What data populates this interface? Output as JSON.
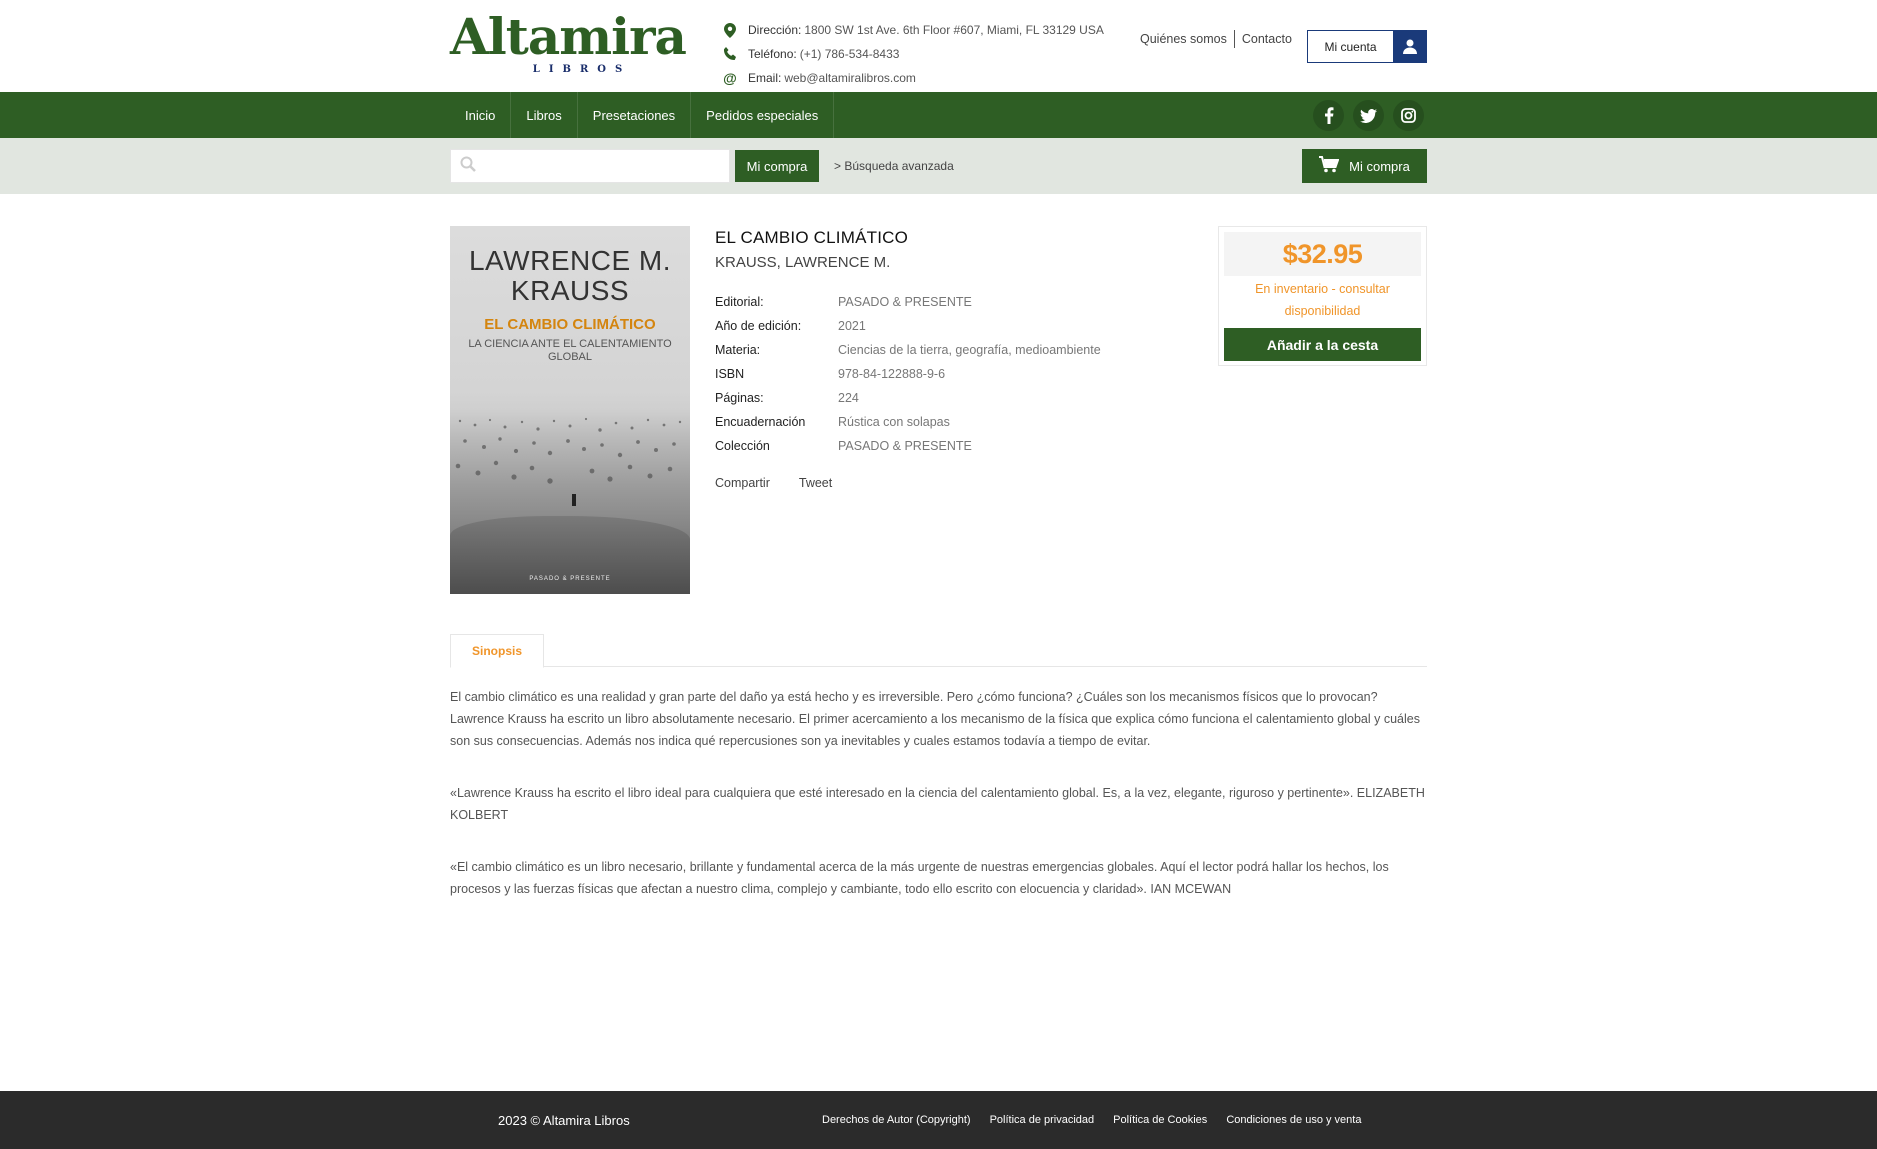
{
  "brand": {
    "logo_main": "Altamira",
    "logo_sub": "LIBROS",
    "primary_color": "#2e5e24",
    "accent_color": "#f0952a"
  },
  "contact": {
    "address_label": "Dirección:",
    "address": "1800 SW 1st Ave. 6th Floor #607, Miami, FL 33129 USA",
    "phone_label": "Teléfono:",
    "phone": "(+1) 786-534-8433",
    "email_label": "Email:",
    "email": "web@altamiralibros.com"
  },
  "top_links": {
    "about": "Quiénes somos",
    "contact": "Contacto",
    "account": "Mi cuenta"
  },
  "nav": {
    "items": [
      "Inicio",
      "Libros",
      "Presetaciones",
      "Pedidos especiales"
    ],
    "social": [
      "facebook-icon",
      "twitter-icon",
      "instagram-icon"
    ]
  },
  "search": {
    "placeholder": "",
    "button": "Mi compra",
    "advanced": "> Búsqueda avanzada",
    "cart": "Mi compra"
  },
  "book": {
    "cover": {
      "author": "LAWRENCE M. KRAUSS",
      "title": "EL CAMBIO CLIMÁTICO",
      "subtitle": "LA CIENCIA ANTE EL CALENTAMIENTO GLOBAL",
      "publisher": "PASADO & PRESENTE"
    },
    "title": "EL CAMBIO CLIMÁTICO",
    "author": "KRAUSS, LAWRENCE M.",
    "details": [
      {
        "label": "Editorial:",
        "value": "PASADO & PRESENTE"
      },
      {
        "label": "Año de edición:",
        "value": "2021"
      },
      {
        "label": "Materia:",
        "value": "Ciencias de la tierra, geografía, medioambiente"
      },
      {
        "label": "ISBN",
        "value": "978-84-122888-9-6"
      },
      {
        "label": "Páginas:",
        "value": "224"
      },
      {
        "label": "Encuadernación",
        "value": "Rústica con solapas"
      },
      {
        "label": "Colección",
        "value": "PASADO & PRESENTE"
      }
    ],
    "share": "Compartir",
    "tweet": "Tweet",
    "price": "$32.95",
    "stock": "En inventario - consultar disponibilidad",
    "add_to_cart": "Añadir a la cesta"
  },
  "tabs": {
    "synopsis": "Sinopsis"
  },
  "synopsis": [
    "El cambio climático es una realidad y gran parte del daño ya está hecho y es irreversible. Pero ¿cómo funciona? ¿Cuáles son los mecanismos físicos que lo provocan? Lawrence Krauss ha escrito un libro absolutamente necesario. El primer acercamiento a los mecanismo de la física que explica cómo funciona el calentamiento global y cuáles son sus consecuencias. Además nos indica qué repercusiones son ya inevitables y cuales estamos todavía a tiempo de evitar.",
    "«Lawrence Krauss ha escrito el libro ideal para cualquiera que esté interesado en la ciencia del calentamiento global. Es, a la vez, elegante, riguroso y pertinente». ELIZABETH KOLBERT",
    "«El cambio climático es un libro necesario, brillante y fundamental acerca de la más urgente de nuestras emergencias globales. Aquí el lector podrá hallar los hechos, los procesos y las fuerzas físicas que afectan a nuestro clima, complejo y cambiante, todo ello escrito con elocuencia y claridad». IAN MCEWAN"
  ],
  "footer": {
    "copyright": "2023 © Altamira Libros",
    "links": [
      "Derechos de Autor (Copyright)",
      "Política de privacidad",
      "Política de Cookies",
      "Condiciones de uso y venta"
    ]
  }
}
